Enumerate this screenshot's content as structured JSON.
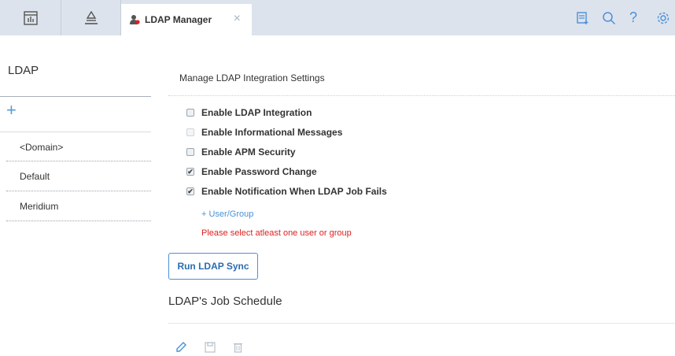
{
  "topbar": {
    "tab_title": "LDAP Manager",
    "left_icons": [
      "dashboard-icon",
      "hierarchy-icon"
    ],
    "right_icons": [
      "notes-add-icon",
      "search-icon",
      "help-icon",
      "settings-icon"
    ],
    "accent": "#4a90d9"
  },
  "sidebar": {
    "title": "LDAP",
    "add_symbol": "+",
    "items": [
      "<Domain>",
      "Default",
      "Meridium"
    ]
  },
  "main": {
    "title": "Manage LDAP Integration Settings",
    "options": [
      {
        "label": "Enable LDAP Integration",
        "checked": false,
        "disabled": false
      },
      {
        "label": "Enable Informational Messages",
        "checked": false,
        "disabled": true
      },
      {
        "label": "Enable APM Security",
        "checked": false,
        "disabled": false
      },
      {
        "label": "Enable Password Change",
        "checked": true,
        "disabled": false
      },
      {
        "label": "Enable Notification When LDAP Job Fails",
        "checked": true,
        "disabled": false
      }
    ],
    "add_user_group": "+ User/Group",
    "error_text": "Please select atleast one user or group",
    "run_button": "Run LDAP Sync",
    "schedule_title": "LDAP's Job Schedule",
    "schedule_icons": [
      "edit-icon",
      "save-icon",
      "delete-icon"
    ],
    "error_color": "#e02020"
  }
}
